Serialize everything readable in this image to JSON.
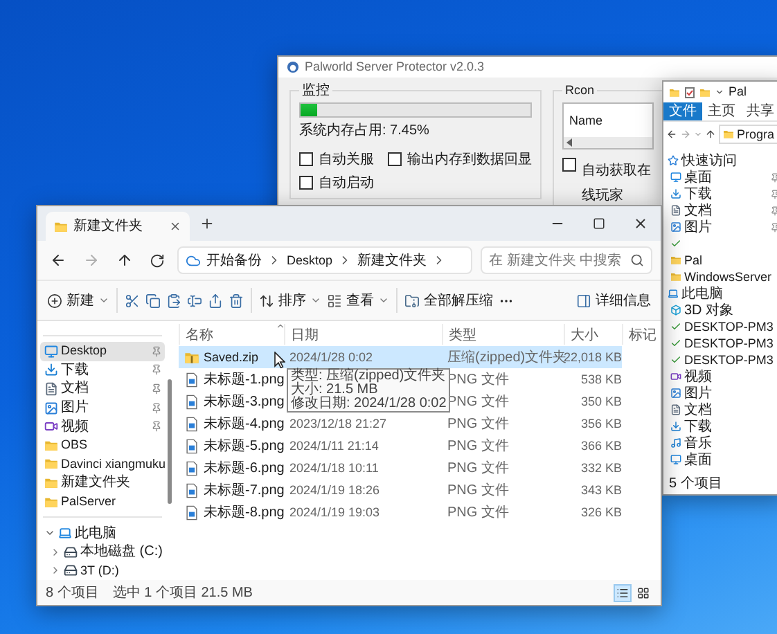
{
  "palworld": {
    "title": "Palworld Server Protector v2.0.3",
    "monitor": {
      "title": "监控",
      "memory": {
        "level": 0.075
      },
      "memory_text": "系统内存占用:  7.45%",
      "options": [
        {
          "label": "自动关服",
          "checked": false
        },
        {
          "label": "输出内存到数据回显",
          "checked": false
        },
        {
          "label": "自动启动",
          "checked": false
        }
      ]
    },
    "rcon": {
      "title": "Rcon",
      "column": "Name",
      "option": {
        "label": "自动获取在线玩家",
        "checked": false
      }
    }
  },
  "pal_explorer": {
    "title": "Pal",
    "ribbon_tabs": [
      {
        "label": "文件",
        "selected": true
      },
      {
        "label": "主页",
        "selected": false
      },
      {
        "label": "共享",
        "selected": false
      }
    ],
    "address": "Progra",
    "tree": [
      {
        "label": "快速访问",
        "kind": "star",
        "children": [
          {
            "label": "桌面",
            "kind": "desktop",
            "pinned": true
          },
          {
            "label": "下载",
            "kind": "download",
            "pinned": true
          },
          {
            "label": "文档",
            "kind": "document",
            "pinned": true
          },
          {
            "label": "图片",
            "kind": "picture",
            "pinned": true
          },
          {
            "kind": "network",
            "pinned": false
          },
          {
            "label": "Pal",
            "kind": "folder",
            "pinned": false
          },
          {
            "label": "WindowsServer",
            "kind": "folder",
            "pinned": false
          }
        ]
      },
      {
        "label": "此电脑",
        "kind": "computer",
        "children": [
          {
            "label": "3D 对象",
            "kind": "cube"
          },
          {
            "label": "DESKTOP-PM3",
            "kind": "network"
          },
          {
            "label": "DESKTOP-PM3",
            "kind": "network"
          },
          {
            "label": "DESKTOP-PM3",
            "kind": "network"
          },
          {
            "label": "视频",
            "kind": "video"
          },
          {
            "label": "图片",
            "kind": "picture"
          },
          {
            "label": "文档",
            "kind": "document"
          },
          {
            "label": "下载",
            "kind": "download"
          },
          {
            "label": "音乐",
            "kind": "music"
          },
          {
            "label": "桌面",
            "kind": "desktop"
          }
        ]
      }
    ],
    "status": "5 个项目"
  },
  "explorer": {
    "tabs": [
      {
        "label": "新建文件夹",
        "selected": true
      }
    ],
    "breadcrumb": [
      "开始备份",
      "Desktop",
      "新建文件夹"
    ],
    "search": {
      "placeholder": "在 新建文件夹 中搜索"
    },
    "toolbar": [
      {
        "kind": "new",
        "label": "新建"
      },
      {
        "kind": "separator"
      },
      {
        "kind": "cut"
      },
      {
        "kind": "copy"
      },
      {
        "kind": "paste"
      },
      {
        "kind": "rename"
      },
      {
        "kind": "share"
      },
      {
        "kind": "delete"
      },
      {
        "kind": "separator"
      },
      {
        "kind": "sort",
        "label": "排序"
      },
      {
        "kind": "view",
        "label": "查看"
      },
      {
        "kind": "separator"
      },
      {
        "kind": "extract",
        "label": "全部解压缩"
      },
      {
        "kind": "more"
      },
      {
        "kind": "spacer"
      },
      {
        "kind": "details",
        "label": "详细信息"
      }
    ],
    "sidebar": {
      "quick_access": [
        {
          "label": "Desktop",
          "kind": "desktop",
          "pinned": true,
          "selected": true
        },
        {
          "label": "下载",
          "kind": "download",
          "pinned": true,
          "selected": false
        },
        {
          "label": "文档",
          "kind": "document",
          "pinned": true,
          "selected": false
        },
        {
          "label": "图片",
          "kind": "picture",
          "pinned": true,
          "selected": false
        },
        {
          "label": "视频",
          "kind": "video",
          "pinned": true,
          "selected": false
        },
        {
          "label": "OBS",
          "kind": "folder",
          "pinned": false,
          "selected": false
        },
        {
          "label": "Davinci xiangmuku",
          "kind": "folder",
          "pinned": false,
          "selected": false
        },
        {
          "label": "新建文件夹",
          "kind": "folder",
          "pinned": false,
          "selected": false
        },
        {
          "label": "PalServer",
          "kind": "folder",
          "pinned": false,
          "selected": false
        }
      ],
      "this_pc": {
        "label": "此电脑",
        "kind": "computer",
        "expanded": true,
        "children": [
          {
            "label": "本地磁盘 (C:)",
            "kind": "drive",
            "expanded": false
          },
          {
            "label": "3T (D:)",
            "kind": "drive",
            "expanded": false
          }
        ]
      }
    },
    "columns": [
      "名称",
      "日期",
      "类型",
      "大小",
      "标记"
    ],
    "rows": [
      {
        "name": "Saved.zip",
        "kind": "zip",
        "date": "2024/1/28 0:02",
        "type": "压缩(zipped)文件夹",
        "size": "22,018 KB",
        "selected": true
      },
      {
        "name": "未标题-1.png",
        "kind": "png",
        "type": "PNG 文件",
        "size": "538 KB",
        "selected": false
      },
      {
        "name": "未标题-3.png",
        "kind": "png",
        "type": "PNG 文件",
        "size": "350 KB",
        "selected": false
      },
      {
        "name": "未标题-4.png",
        "kind": "png",
        "date": "2023/12/18 21:27",
        "type": "PNG 文件",
        "size": "356 KB",
        "selected": false
      },
      {
        "name": "未标题-5.png",
        "kind": "png",
        "date": "2024/1/11 21:14",
        "type": "PNG 文件",
        "size": "366 KB",
        "selected": false
      },
      {
        "name": "未标题-6.png",
        "kind": "png",
        "date": "2024/1/18 10:11",
        "type": "PNG 文件",
        "size": "332 KB",
        "selected": false
      },
      {
        "name": "未标题-7.png",
        "kind": "png",
        "date": "2024/1/19 18:26",
        "type": "PNG 文件",
        "size": "343 KB",
        "selected": false
      },
      {
        "name": "未标题-8.png",
        "kind": "png",
        "date": "2024/1/19 19:03",
        "type": "PNG 文件",
        "size": "326 KB",
        "selected": false
      }
    ],
    "tooltip": [
      "类型: 压缩(zipped)文件夹",
      "大小: 21.5 MB",
      "修改日期: 2024/1/28 0:02"
    ],
    "status": {
      "count": "8 个项目",
      "selection": "选中 1 个项目  21.5 MB"
    },
    "view_modes": [
      {
        "kind": "details",
        "selected": true
      },
      {
        "kind": "tiles",
        "selected": false
      }
    ]
  }
}
